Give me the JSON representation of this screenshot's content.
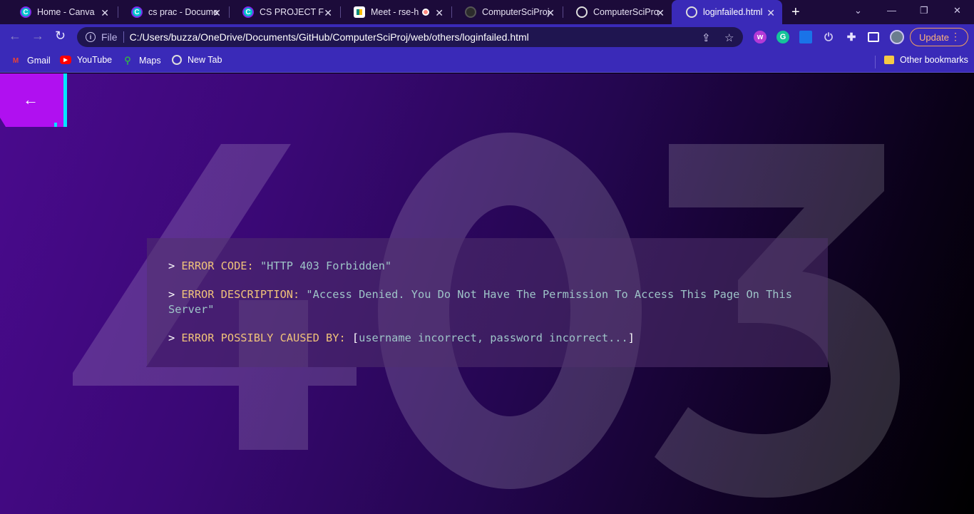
{
  "browser": {
    "tabs": [
      {
        "title": "Home - Canva",
        "icon": "canva-icon"
      },
      {
        "title": "cs prac - Docume",
        "icon": "canva-icon"
      },
      {
        "title": "CS PROJECT FILE",
        "icon": "canva-icon"
      },
      {
        "title": "Meet - rse-h",
        "icon": "google-meet-icon"
      },
      {
        "title": "ComputerSciProj",
        "icon": "github-icon"
      },
      {
        "title": "ComputerSciProj",
        "icon": "globe-icon"
      },
      {
        "title": "loginfailed.html",
        "icon": "globe-icon",
        "active": true
      }
    ],
    "address": {
      "scheme": "File",
      "url": "C:/Users/buzza/OneDrive/Documents/GitHub/ComputerSciProj/web/others/loginfailed.html"
    },
    "update_label": "Update",
    "bookmarks": [
      {
        "label": "Gmail",
        "icon": "gmail-icon"
      },
      {
        "label": "YouTube",
        "icon": "youtube-icon"
      },
      {
        "label": "Maps",
        "icon": "maps-icon"
      },
      {
        "label": "New Tab",
        "icon": "globe-icon"
      }
    ],
    "other_bookmarks": "Other bookmarks"
  },
  "page": {
    "background_code": "403",
    "error": {
      "code_key": "ERROR CODE:",
      "code_value": "\"HTTP 403 Forbidden\"",
      "desc_key": "ERROR DESCRIPTION:",
      "desc_value_line1": "\"Access Denied. You Do Not Have The Permission To Access This Page On This",
      "desc_value_line2": "Server\"",
      "cause_key": "ERROR POSSIBLY CAUSED BY:",
      "cause_value": "username incorrect, password incorrect..."
    }
  },
  "colors": {
    "chrome_dark": "#1c0b3a",
    "chrome_accent": "#3a2ab8",
    "back_button": "#b010f0",
    "back_button_edge": "#00e5ff",
    "error_key": "#f0c27a",
    "error_value": "#9ec4c8"
  }
}
